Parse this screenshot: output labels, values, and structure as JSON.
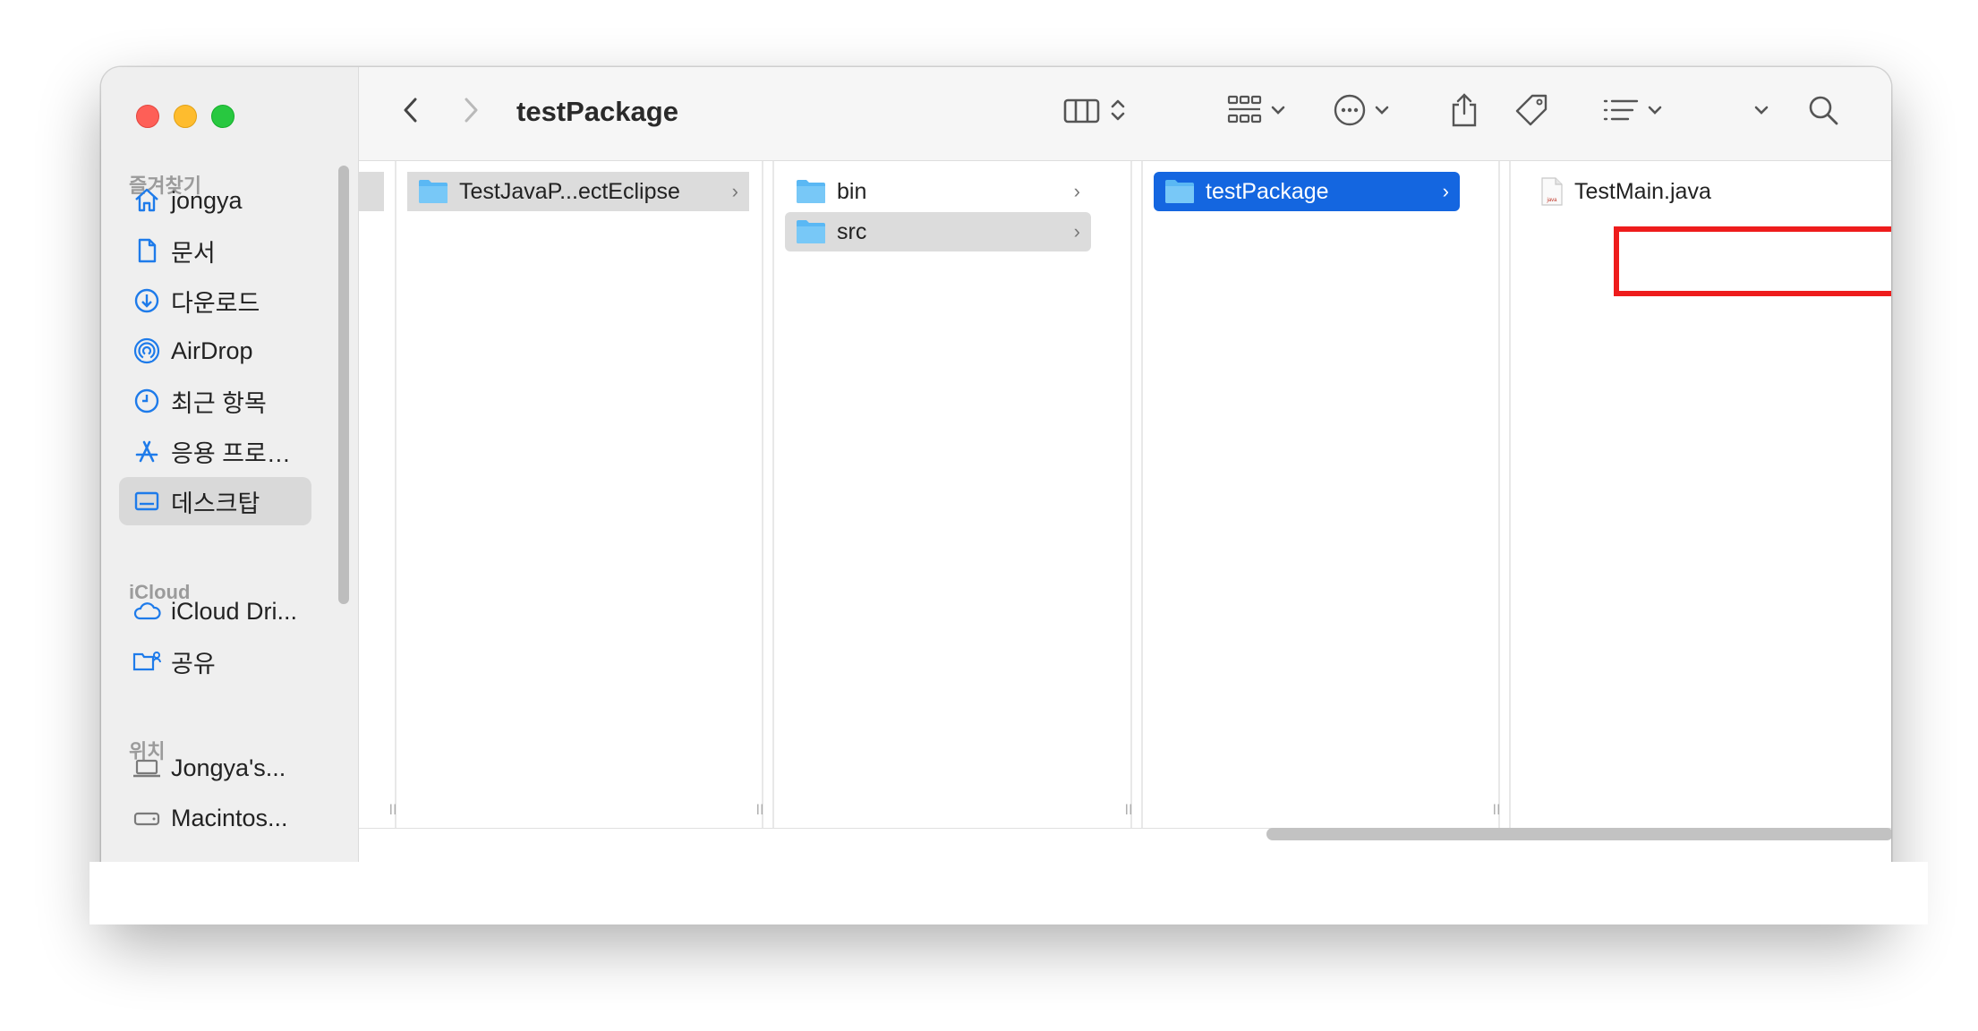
{
  "window": {
    "title": "testPackage"
  },
  "sidebar": {
    "sections": [
      {
        "title": "즐겨찾기",
        "items": [
          {
            "label": "jongya",
            "icon": "home-icon"
          },
          {
            "label": "문서",
            "icon": "document-icon"
          },
          {
            "label": "다운로드",
            "icon": "download-icon"
          },
          {
            "label": "AirDrop",
            "icon": "airdrop-icon"
          },
          {
            "label": "최근 항목",
            "icon": "clock-icon"
          },
          {
            "label": "응용 프로…",
            "icon": "applications-icon"
          },
          {
            "label": "데스크탑",
            "icon": "desktop-icon",
            "selected": true
          }
        ]
      },
      {
        "title": "iCloud",
        "items": [
          {
            "label": "iCloud Dri...",
            "icon": "cloud-icon"
          },
          {
            "label": "공유",
            "icon": "shared-folder-icon"
          }
        ]
      },
      {
        "title": "위치",
        "items": [
          {
            "label": "Jongya's...",
            "icon": "laptop-icon"
          },
          {
            "label": "Macintos...",
            "icon": "disk-icon"
          }
        ]
      }
    ]
  },
  "toolbar": {
    "icons": [
      "back-icon",
      "forward-icon",
      "column-view-icon",
      "group-icon",
      "more-icon",
      "share-icon",
      "tag-icon",
      "sort-icon",
      "chevron-down-icon",
      "search-icon"
    ]
  },
  "columns": [
    {
      "items": [
        {
          "label": "TestJavaP...ectEclipse",
          "type": "folder",
          "state": "path"
        }
      ]
    },
    {
      "items": [
        {
          "label": "bin",
          "type": "folder",
          "state": "none"
        },
        {
          "label": "src",
          "type": "folder",
          "state": "path"
        }
      ]
    },
    {
      "items": [
        {
          "label": "testPackage",
          "type": "folder",
          "state": "selected"
        }
      ]
    },
    {
      "items": [
        {
          "label": "TestMain.java",
          "type": "java-file",
          "state": "none",
          "badge": "java"
        }
      ]
    }
  ],
  "colors": {
    "selection": "#1466e0",
    "highlight_box": "#ee1c1c",
    "folder": "#5ab8f4"
  }
}
